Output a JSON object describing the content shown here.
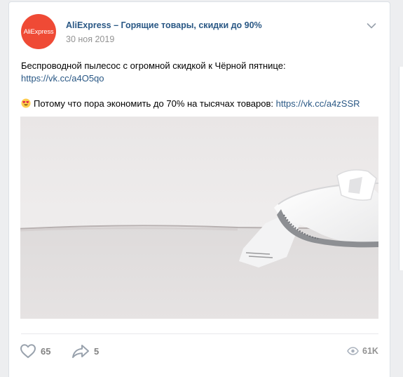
{
  "post": {
    "author": {
      "name": "AliExpress – Горящие товары, скидки до 90%",
      "avatar_text": "AliExpress",
      "avatar_color": "#ef4a35"
    },
    "date": "30 ноя 2019",
    "text": {
      "line1": "Беспроводной пылесос с огромной скидкой к Чёрной пятнице:",
      "link1": "https://vk.cc/a4O5qo",
      "line2": "Потому что пора экономить до 70% на тысячах товаров:",
      "link2": "https://vk.cc/a4zSSR",
      "emoji": "smiling-face-with-heart-eyes"
    },
    "media": {
      "type": "video",
      "description_icon": "vacuum-cleaner-image"
    },
    "actions": {
      "likes": "65",
      "shares": "5",
      "views": "61K"
    }
  },
  "colors": {
    "link": "#2a5885",
    "muted": "#828282",
    "page_bg": "#edeef0"
  }
}
